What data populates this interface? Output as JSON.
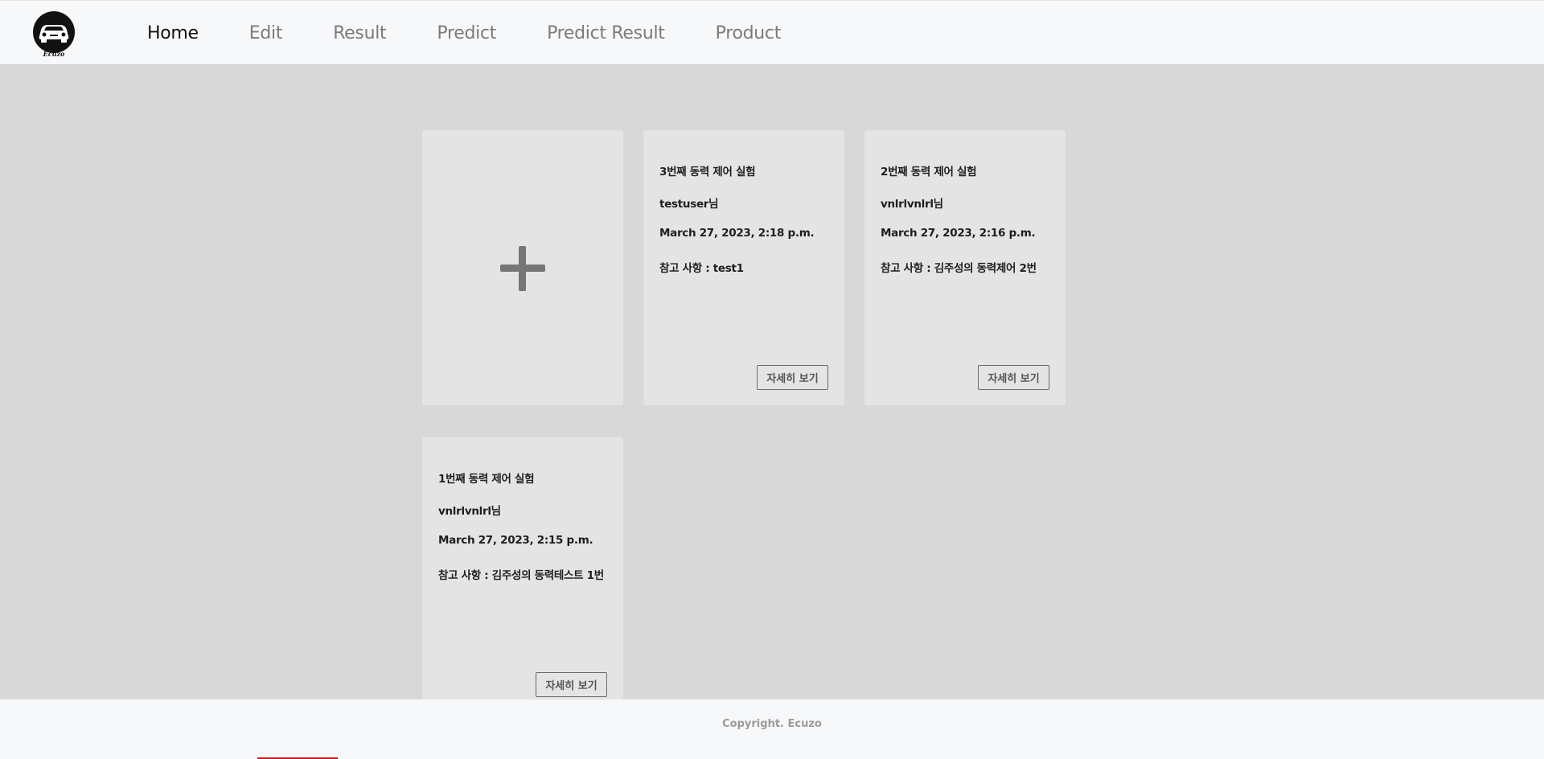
{
  "brand": {
    "logo_text": "Ecuzo",
    "icon": "car-icon"
  },
  "nav": {
    "items": [
      {
        "label": "Home",
        "active": true
      },
      {
        "label": "Edit",
        "active": false
      },
      {
        "label": "Result",
        "active": false
      },
      {
        "label": "Predict",
        "active": false
      },
      {
        "label": "Predict Result",
        "active": false
      },
      {
        "label": "Product",
        "active": false
      }
    ]
  },
  "add_card": {
    "icon": "plus-icon"
  },
  "experiments": [
    {
      "title": "3번째 동력 제어 실험",
      "user": "testuser님",
      "date": "March 27, 2023, 2:18 p.m.",
      "note": "참고 사항 : test1",
      "button": "자세히 보기"
    },
    {
      "title": "2번째 동력 제어 실험",
      "user": "vnlrlvnlrl님",
      "date": "March 27, 2023, 2:16 p.m.",
      "note": "참고 사항 : 김주성의 동력제어 2번",
      "button": "자세히 보기"
    },
    {
      "title": "1번째 동력 제어 실험",
      "user": "vnlrlvnlrl님",
      "date": "March 27, 2023, 2:15 p.m.",
      "note": "참고 사항 : 김주성의 동력테스트 1번",
      "button": "자세히 보기"
    }
  ],
  "footer": {
    "copyright": "Copyright. Ecuzo"
  },
  "colors": {
    "page_bg": "#d9d8d9",
    "card_bg": "#e4e4e4",
    "nav_bg": "#f7f8fa",
    "active_nav": "#111111",
    "inactive_nav": "#7b7b7b"
  }
}
